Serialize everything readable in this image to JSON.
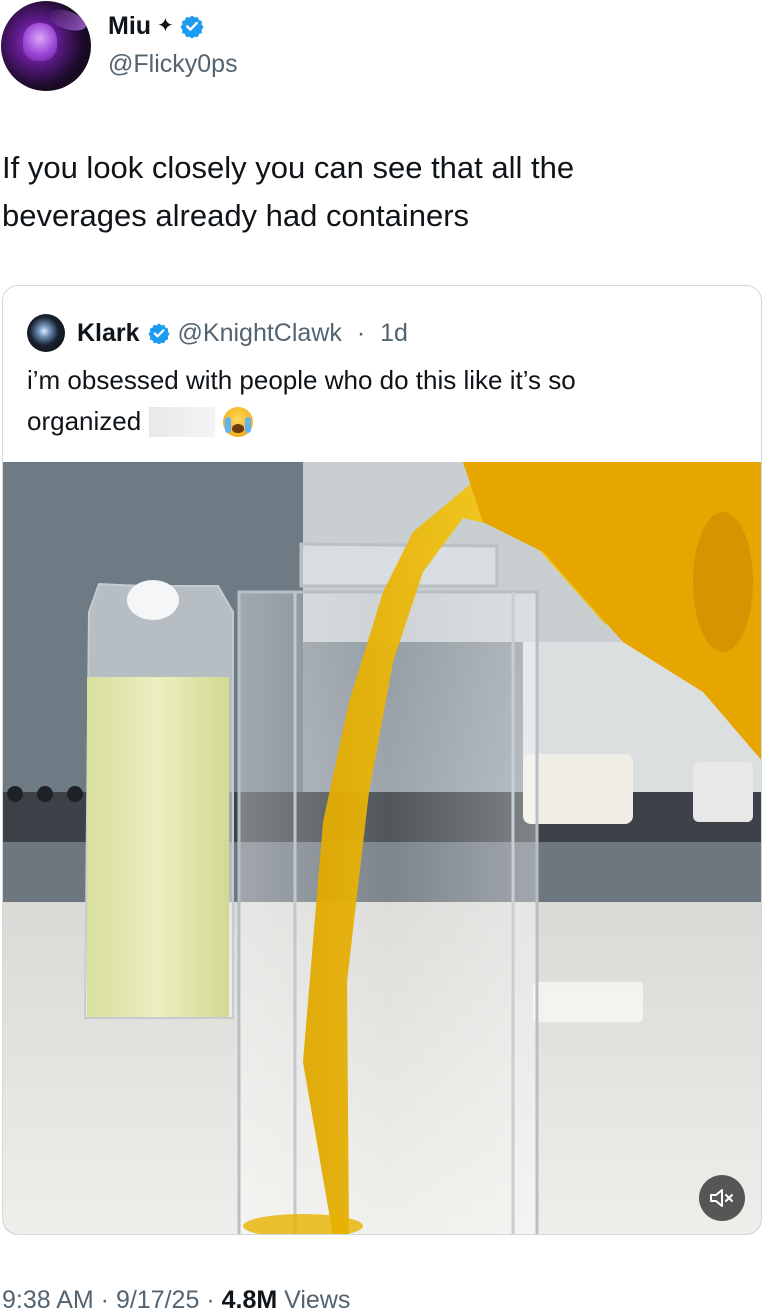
{
  "author": {
    "display_name": "Miu",
    "badge_glyph": "✦",
    "handle": "@Flicky0ps",
    "verified": true,
    "verified_color": "#1d9bf0"
  },
  "tweet": {
    "text_line1": "If you look closely you can see that all the",
    "text_line2": "beverages already had containers"
  },
  "quoted_tweet": {
    "display_name": "Klark",
    "verified": true,
    "handle": "@KnightClawk",
    "separator": " · ",
    "age": "1d",
    "text_line1": "i’m obsessed with people who do this like it’s so",
    "text_line2": "organized",
    "emoji": "loudly-crying-face",
    "media": {
      "type": "video",
      "muted": true,
      "mute_icon": "speaker-muted-icon"
    }
  },
  "meta": {
    "time": "9:38 AM",
    "date": "9/17/25",
    "separator": " · ",
    "views_count": "4.8M",
    "views_label": " Views"
  }
}
